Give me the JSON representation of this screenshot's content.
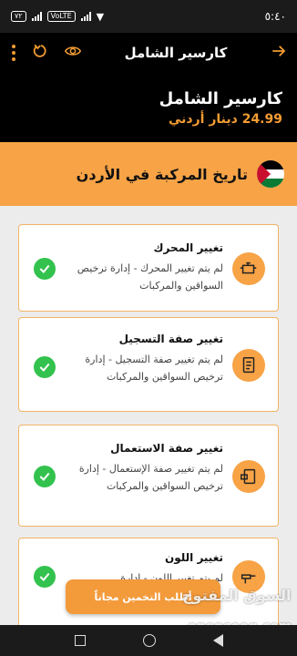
{
  "status_bar": {
    "time": "٥:٤٠",
    "pill_label": "VoLTE",
    "net_label": "٧٢"
  },
  "app_bar": {
    "title": "كارسير الشامل"
  },
  "hero": {
    "title": "كارسير الشامل",
    "price": "24.99 دينار أردني"
  },
  "section": {
    "title": "تاريخ المركبة في الأردن"
  },
  "cards": [
    {
      "title": "تغيير المحرك",
      "desc": "لم يتم تغيير المحرك - إدارة ترخيص السواقين والمركبات"
    },
    {
      "title": "تغيير صفة التسجيل",
      "desc": "لم يتم تغيير صفة التسجيل - إدارة ترخيص السواقين والمركبات"
    },
    {
      "title": "تغيير صفة الاستعمال",
      "desc": "لم يتم تغيير صفة الإستعمال - إدارة ترخيص السواقين والمركبات"
    },
    {
      "title": "تغيير اللون",
      "desc": "لم يتم تغيير اللون - إدارة"
    }
  ],
  "fab": {
    "label": "أطلب التخمين مجاناً"
  },
  "watermark": {
    "text": "السوق المفتوح",
    "brand": "opensooq.com"
  },
  "colors": {
    "accent": "#f39c33",
    "check": "#32c24d",
    "header_bg": "#000000"
  }
}
